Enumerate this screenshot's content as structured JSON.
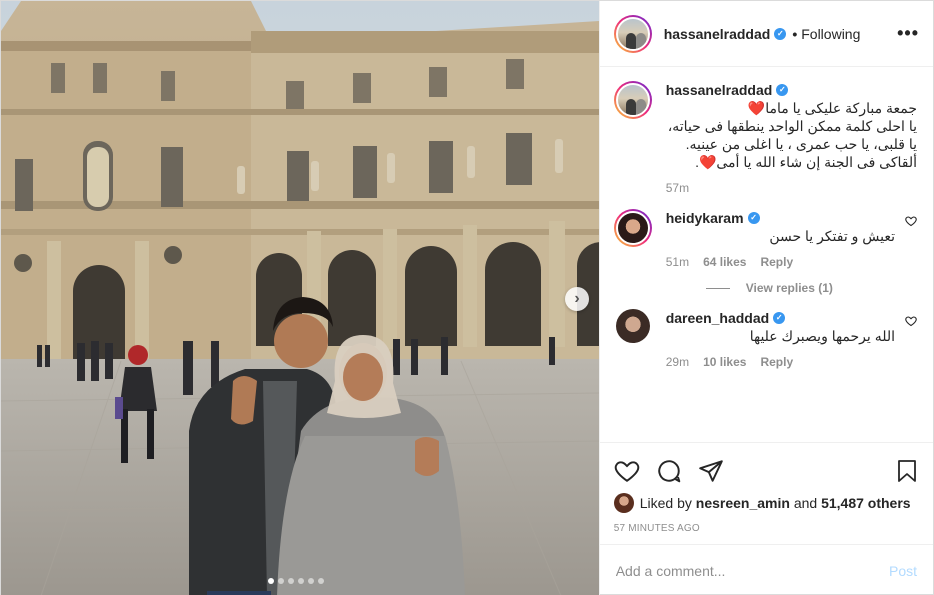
{
  "post": {
    "author": "hassanelraddad",
    "follow_status": "Following",
    "separator": "•",
    "more_icon": "more-options-icon",
    "carousel": {
      "slides": 6,
      "active_index": 0
    }
  },
  "caption": {
    "username": "hassanelraddad",
    "text": "جمعة مباركة عليكى يا ماما❤️\nيا احلى كلمة ممكن الواحد ينطقها فى حياته، يا قلبى، يا حب عمرى ، يا اغلى من عينيه.\nألقاكى فى الجنة إن شاء الله يا أمى❤️.",
    "time": "57m"
  },
  "comments": [
    {
      "username": "heidykaram",
      "text": "تعيش و تفتكر يا حسن",
      "time": "51m",
      "likes": "64 likes",
      "reply": "Reply",
      "view_replies": "View replies (1)"
    },
    {
      "username": "dareen_haddad",
      "text": "الله يرحمها ويصبرك عليها",
      "time": "29m",
      "likes": "10 likes",
      "reply": "Reply"
    }
  ],
  "likes": {
    "prefix": "Liked by",
    "user": "nesreen_amin",
    "and": "and",
    "others": "51,487 others"
  },
  "timestamp": "57 MINUTES AGO",
  "add_comment": {
    "placeholder": "Add a comment...",
    "post_label": "Post"
  },
  "colors": {
    "verified": "#3897f0",
    "heart": "#ed4956",
    "post_disabled": "#b3dbff"
  }
}
